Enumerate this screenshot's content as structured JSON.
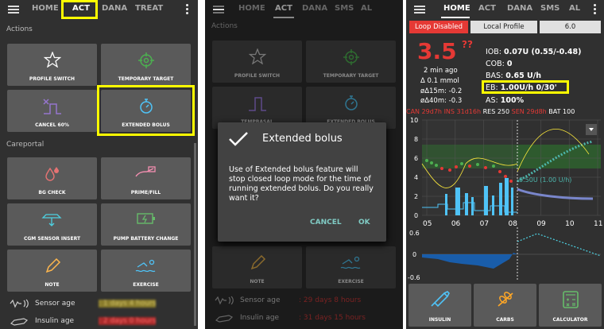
{
  "panel1": {
    "tabs": [
      "HOME",
      "ACT",
      "DANA",
      "TREAT"
    ],
    "actions_header": "Actions",
    "careportal_header": "Careportal",
    "buttons": {
      "profile_switch": "PROFILE SWITCH",
      "temp_target": "TEMPORARY TARGET",
      "cancel": "CANCEL 60%",
      "extended_bolus": "EXTENDED BOLUS",
      "bg_check": "BG CHECK",
      "prime_fill": "PRIME/FILL",
      "cgm_sensor": "CGM SENSOR INSERT",
      "pump_battery": "PUMP BATTERY CHANGE",
      "note": "NOTE",
      "exercise": "EXERCISE"
    },
    "sensor_age_label": "Sensor age",
    "insulin_age_label": "Insulin age",
    "sensor_age_value": ": 1 days 4 hours",
    "insulin_age_value": ": 2 days 0 hours"
  },
  "panel2": {
    "tabs": [
      "HOME",
      "ACT",
      "DANA",
      "SMS",
      "AL"
    ],
    "actions_header": "Actions",
    "buttons": {
      "profile_switch": "PROFILE SWITCH",
      "temp_target": "TEMPORARY TARGET",
      "tempbasal": "TEMPBASAL",
      "extended_bolus": "EXTENDED BOLUS",
      "note": "NOTE",
      "exercise": "EXERCISE"
    },
    "dialog": {
      "title": "Extended bolus",
      "message": "Use of Extended bolus feature will stop closed loop mode for the time of running extended bolus. Do you really want it?",
      "cancel": "CANCEL",
      "ok": "OK"
    },
    "sensor_age_label": "Sensor age",
    "insulin_age_label": "Insulin age",
    "sensor_age_value": ": 29 days 8 hours",
    "insulin_age_value": ": 31 days 15 hours"
  },
  "panel3": {
    "tabs": [
      "HOME",
      "ACT",
      "DANA",
      "SMS",
      "AL"
    ],
    "loop_status": "Loop Disabled",
    "profile": "Local Profile",
    "target": "6.0",
    "bg": "3.5",
    "bg_flag": "??",
    "time_ago": "2 min ago",
    "delta": "Δ 0.1 mmol",
    "avg15": "øΔ15m: -0.2",
    "avg40": "øΔ40m: -0.3",
    "iob_label": "IOB:",
    "iob": "0.07U (0.55/-0.48)",
    "cob_label": "COB:",
    "cob": "0",
    "bas_label": "BAS:",
    "bas": "0.65 U/h",
    "eb_label": "EB:",
    "eb": "1.00U/h 0/30'",
    "as_label": "AS:",
    "as": "100%",
    "status": {
      "can": "CAN 29d7h",
      "ins": "INS 31d16h",
      "res": "RES 250",
      "sen": "SEN 29d8h",
      "bat": "BAT 100"
    },
    "chart_data": [
      {
        "type": "line",
        "x": [
          "05",
          "06",
          "07",
          "08",
          "09",
          "10",
          "11"
        ],
        "yticks": [
          "0",
          "2",
          "4",
          "6",
          "8",
          "10"
        ],
        "ylim": [
          0,
          10
        ],
        "annotation": "0.50U (1.00 U/h)"
      },
      {
        "type": "area",
        "yticks": [
          "0.6",
          "0",
          "-0.6"
        ],
        "ylim": [
          -0.6,
          0.6
        ]
      }
    ],
    "buttons": {
      "insulin": "INSULIN",
      "carbs": "CARBS",
      "calculator": "CALCULATOR"
    }
  },
  "colors": {
    "highlight": "#ffff00",
    "red": "#e53935",
    "teal": "#80cbc4",
    "green_zone": "#2e5a2e"
  }
}
